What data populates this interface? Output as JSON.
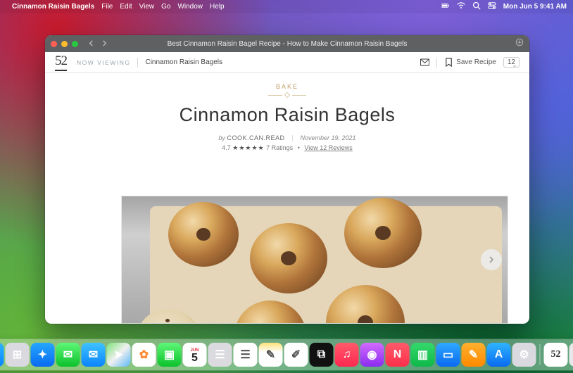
{
  "menubar": {
    "app_name": "Cinnamon Raisin Bagels",
    "items": [
      "File",
      "Edit",
      "View",
      "Go",
      "Window",
      "Help"
    ],
    "clock": "Mon Jun 5 9:41 AM"
  },
  "window": {
    "title": "Best Cinnamon Raisin Bagel Recipe - How to Make Cinnamon Raisin Bagels"
  },
  "sitebar": {
    "logo": "52",
    "now_viewing_label": "NOW VIEWING",
    "breadcrumb": "Cinnamon Raisin Bagels",
    "save_label": "Save Recipe",
    "comment_count": "12"
  },
  "article": {
    "category": "BAKE",
    "title": "Cinnamon Raisin Bagels",
    "by_label": "by",
    "author": "COOK.CAN.READ",
    "date": "November 19, 2021",
    "rating_value": "4.7",
    "stars": "★★★★★",
    "ratings_label": "7 Ratings",
    "reviews_link": "View 12 Reviews"
  },
  "dock": {
    "icons": [
      {
        "name": "finder-icon",
        "bg": "linear-gradient(180deg,#2fb4ff,#0a84ff)",
        "glyph": "☺"
      },
      {
        "name": "launchpad-icon",
        "bg": "#d9d9df",
        "glyph": "⊞"
      },
      {
        "name": "safari-icon",
        "bg": "linear-gradient(180deg,#24a7ff,#0a6af0)",
        "glyph": "✦"
      },
      {
        "name": "messages-icon",
        "bg": "linear-gradient(180deg,#5ef777,#0bc12b)",
        "glyph": "✉"
      },
      {
        "name": "mail-icon",
        "bg": "linear-gradient(180deg,#3fc3ff,#0a84ff)",
        "glyph": "✉"
      },
      {
        "name": "maps-icon",
        "bg": "linear-gradient(135deg,#7de37a,#f0f0f0 50%,#5ab8f7)",
        "glyph": "➤"
      },
      {
        "name": "photos-icon",
        "bg": "#fff",
        "glyph": "✿"
      },
      {
        "name": "facetime-icon",
        "bg": "linear-gradient(180deg,#5ef777,#0bc12b)",
        "glyph": "▣"
      },
      {
        "name": "calendar-icon",
        "bg": "#fff",
        "glyph": "5"
      },
      {
        "name": "contacts-icon",
        "bg": "#dadadf",
        "glyph": "☰"
      },
      {
        "name": "reminders-icon",
        "bg": "#fff",
        "glyph": "☰"
      },
      {
        "name": "notes-icon",
        "bg": "linear-gradient(180deg,#ffe27a,#fff 40%)",
        "glyph": "✎"
      },
      {
        "name": "freeform-icon",
        "bg": "#fff",
        "glyph": "✐"
      },
      {
        "name": "tv-icon",
        "bg": "#111",
        "glyph": "⧉"
      },
      {
        "name": "music-icon",
        "bg": "linear-gradient(180deg,#ff5a6a,#ff2750)",
        "glyph": "♫"
      },
      {
        "name": "podcasts-icon",
        "bg": "linear-gradient(180deg,#d26bff,#8a2cf0)",
        "glyph": "◉"
      },
      {
        "name": "news-icon",
        "bg": "linear-gradient(180deg,#ff5a6a,#ff2f4a)",
        "glyph": "N"
      },
      {
        "name": "numbers-icon",
        "bg": "linear-gradient(180deg,#34d96a,#0fb84a)",
        "glyph": "▥"
      },
      {
        "name": "keynote-icon",
        "bg": "linear-gradient(180deg,#2fa8ff,#0a6af0)",
        "glyph": "▭"
      },
      {
        "name": "pages-icon",
        "bg": "linear-gradient(180deg,#ffb02f,#ff8a00)",
        "glyph": "✎"
      },
      {
        "name": "appstore-icon",
        "bg": "linear-gradient(180deg,#2fb4ff,#0a6af0)",
        "glyph": "A"
      },
      {
        "name": "settings-icon",
        "bg": "#d9d9df",
        "glyph": "⚙"
      },
      {
        "name": "food52-icon",
        "bg": "#fff",
        "glyph": "52"
      },
      {
        "name": "trash-icon",
        "bg": "#e8e8ea",
        "glyph": "🗑"
      }
    ]
  }
}
